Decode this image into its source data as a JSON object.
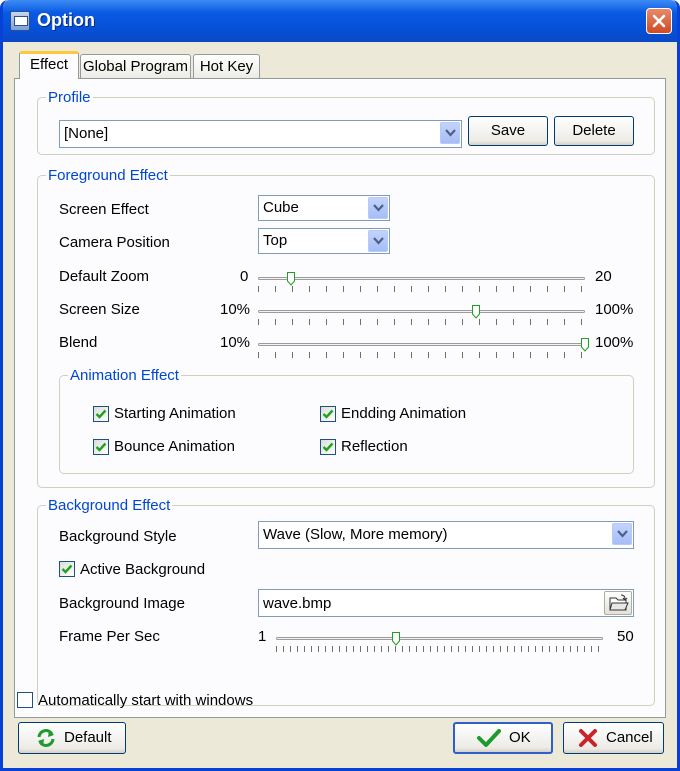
{
  "window": {
    "title": "Option"
  },
  "tabs": [
    {
      "label": "Effect"
    },
    {
      "label": "Global Program"
    },
    {
      "label": "Hot Key"
    }
  ],
  "profile": {
    "legend": "Profile",
    "selected": "[None]",
    "save_label": "Save",
    "delete_label": "Delete"
  },
  "foreground": {
    "legend": "Foreground Effect",
    "screen_effect": {
      "label": "Screen Effect",
      "value": "Cube"
    },
    "camera_position": {
      "label": "Camera Position",
      "value": "Top"
    },
    "default_zoom": {
      "label": "Default Zoom",
      "min_label": "0",
      "max_label": "20",
      "value": 2
    },
    "screen_size": {
      "label": "Screen Size",
      "min_label": "10%",
      "max_label": "100%",
      "value": 70
    },
    "blend": {
      "label": "Blend",
      "min_label": "10%",
      "max_label": "100%",
      "value": 100
    }
  },
  "animation": {
    "legend": "Animation Effect",
    "starting": {
      "label": "Starting Animation",
      "checked": true
    },
    "ending": {
      "label": "Endding Animation",
      "checked": true
    },
    "bounce": {
      "label": "Bounce Animation",
      "checked": true
    },
    "reflection": {
      "label": "Reflection",
      "checked": true
    }
  },
  "background": {
    "legend": "Background Effect",
    "style": {
      "label": "Background Style",
      "value": "Wave (Slow, More memory)"
    },
    "active": {
      "label": "Active Background",
      "checked": true
    },
    "image": {
      "label": "Background Image",
      "value": "wave.bmp"
    },
    "fps": {
      "label": "Frame Per Sec",
      "min_label": "1",
      "max_label": "50",
      "value": 19
    }
  },
  "autostart": {
    "label": "Automatically start with windows",
    "checked": false
  },
  "footer": {
    "default_label": "Default",
    "ok_label": "OK",
    "cancel_label": "Cancel"
  },
  "colors": {
    "accent": "#0046d5",
    "titlebar": "#0650d8",
    "check": "#21a121"
  }
}
